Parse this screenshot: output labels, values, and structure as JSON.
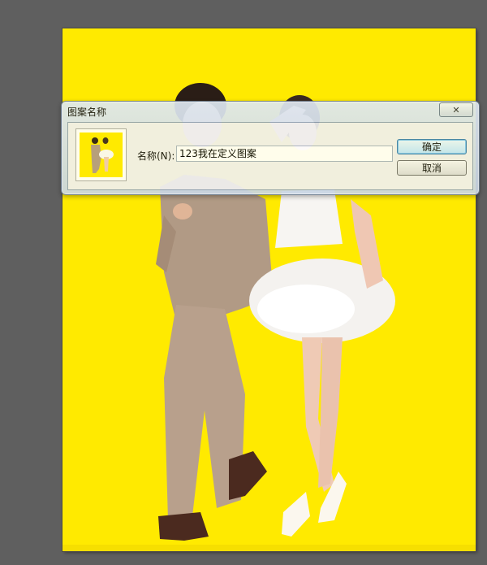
{
  "dialog": {
    "title": "图案名称",
    "close_label": "✕",
    "name_label": "名称(N):",
    "name_value": "123我在定义图案",
    "ok_label": "确定",
    "cancel_label": "取消"
  },
  "colors": {
    "workspace": "#5f5f5f",
    "canvas_background": "#ffea00",
    "dialog_frame": "#c9d6e4"
  }
}
